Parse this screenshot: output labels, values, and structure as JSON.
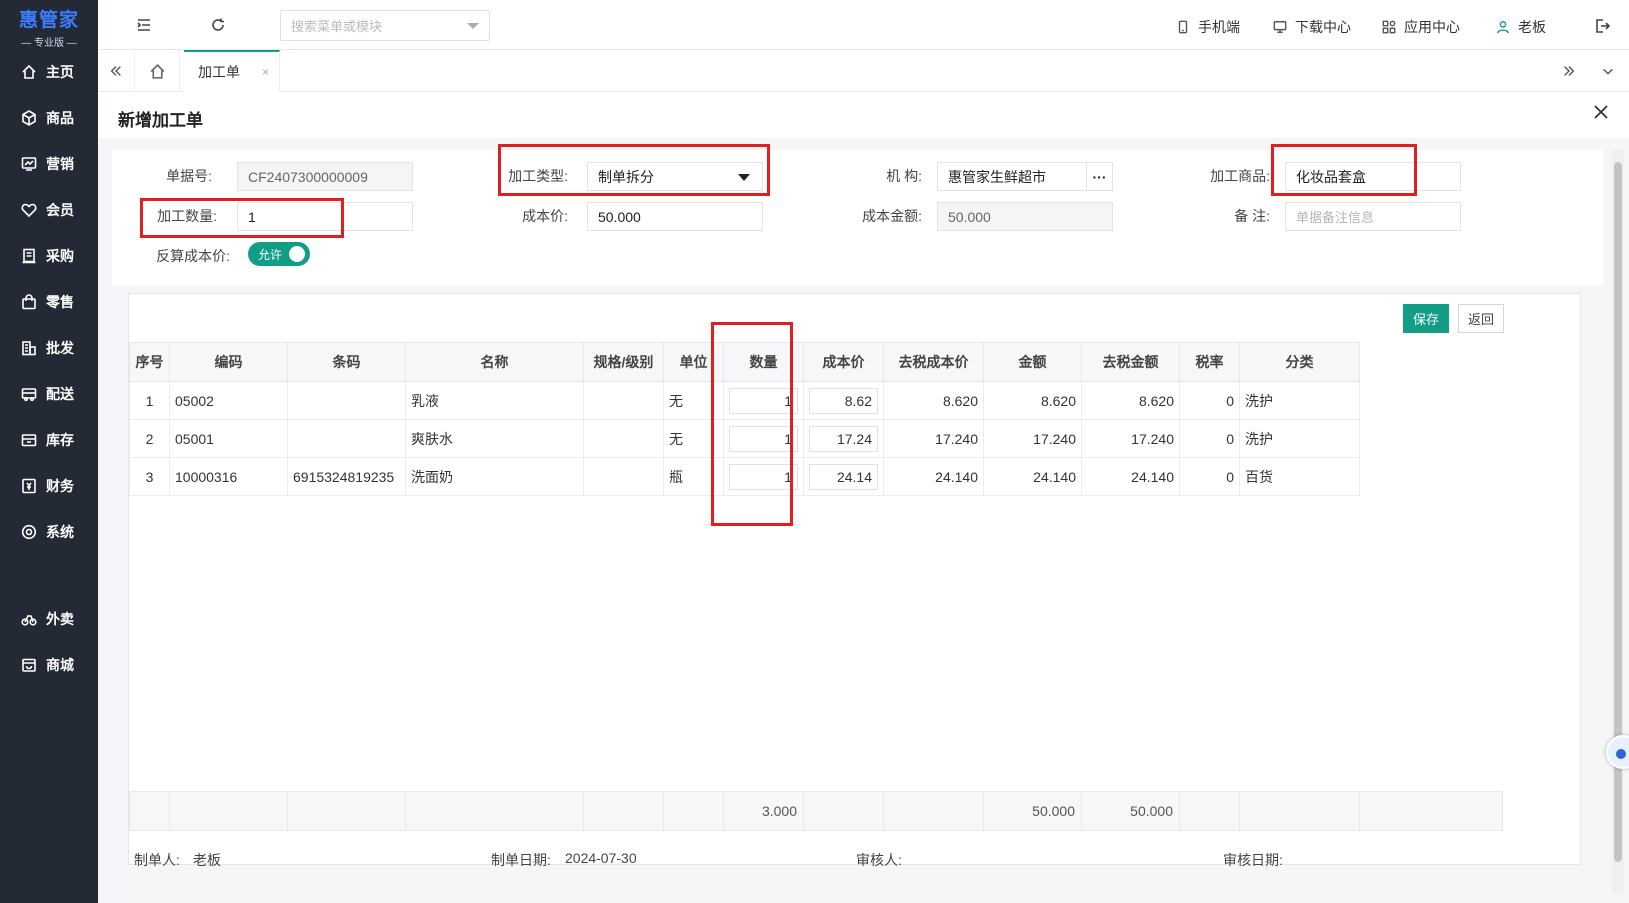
{
  "app": {
    "logo": "惠管家",
    "edition": "— 专业版 —"
  },
  "sidebar": {
    "items": [
      {
        "label": "主页",
        "icon": "home-icon"
      },
      {
        "label": "商品",
        "icon": "cube-icon"
      },
      {
        "label": "营销",
        "icon": "chart-icon"
      },
      {
        "label": "会员",
        "icon": "heart-icon"
      },
      {
        "label": "采购",
        "icon": "purchase-icon"
      },
      {
        "label": "零售",
        "icon": "bag-icon"
      },
      {
        "label": "批发",
        "icon": "building-icon"
      },
      {
        "label": "配送",
        "icon": "truck-icon"
      },
      {
        "label": "库存",
        "icon": "inventory-icon"
      },
      {
        "label": "财务",
        "icon": "finance-icon"
      },
      {
        "label": "系统",
        "icon": "system-icon"
      },
      {
        "label": "外卖",
        "icon": "bike-icon"
      },
      {
        "label": "商城",
        "icon": "store-icon"
      }
    ]
  },
  "topbar": {
    "search_placeholder": "搜索菜单或模块",
    "mobile": "手机端",
    "download": "下载中心",
    "apps": "应用中心",
    "user": "老板"
  },
  "tabs": {
    "active": "加工单",
    "close": "×"
  },
  "panel": {
    "title": "新增加工单",
    "form": {
      "doc_no_label": "单据号:",
      "doc_no": "CF2407300000009",
      "type_label": "加工类型:",
      "type": "制单拆分",
      "org_label": "机 构:",
      "org": "惠管家生鲜超市",
      "org_btn": "···",
      "product_label": "加工商品:",
      "product": "化妆品套盒",
      "qty_label": "加工数量:",
      "qty": "1",
      "cost_label": "成本价:",
      "cost": "50.000",
      "amount_label": "成本金额:",
      "amount": "50.000",
      "remark_label": "备 注:",
      "remark_placeholder": "单据备注信息",
      "reverse_label": "反算成本价:",
      "reverse_toggle": "允许"
    },
    "buttons": {
      "save": "保存",
      "back": "返回"
    },
    "grid": {
      "headers": [
        "序号",
        "编码",
        "条码",
        "名称",
        "规格/级别",
        "单位",
        "数量",
        "成本价",
        "去税成本价",
        "金额",
        "去税金额",
        "税率",
        "分类"
      ],
      "rows": [
        {
          "seq": "1",
          "code": "05002",
          "barcode": "",
          "name": "乳液",
          "spec": "",
          "unit": "无",
          "qty": "1",
          "cost": "8.62",
          "cost_ex": "8.620",
          "amount": "8.620",
          "amount_ex": "8.620",
          "tax": "0",
          "category": "洗护"
        },
        {
          "seq": "2",
          "code": "05001",
          "barcode": "",
          "name": "爽肤水",
          "spec": "",
          "unit": "无",
          "qty": "1",
          "cost": "17.24",
          "cost_ex": "17.240",
          "amount": "17.240",
          "amount_ex": "17.240",
          "tax": "0",
          "category": "洗护"
        },
        {
          "seq": "3",
          "code": "10000316",
          "barcode": "6915324819235",
          "name": "洗面奶",
          "spec": "",
          "unit": "瓶",
          "qty": "1",
          "cost": "24.14",
          "cost_ex": "24.140",
          "amount": "24.140",
          "amount_ex": "24.140",
          "tax": "0",
          "category": "百货"
        }
      ],
      "footer": {
        "qty_total": "3.000",
        "amount_total": "50.000",
        "amount_ex_total": "50.000"
      }
    },
    "meta": {
      "maker_label": "制单人:",
      "maker": "老板",
      "date_label": "制单日期:",
      "date": "2024-07-30",
      "auditor_label": "审核人:",
      "audit_date_label": "审核日期:"
    }
  },
  "colors": {
    "accent": "#129d86",
    "sidebar_bg": "#232a36",
    "highlight": "#e02020"
  }
}
